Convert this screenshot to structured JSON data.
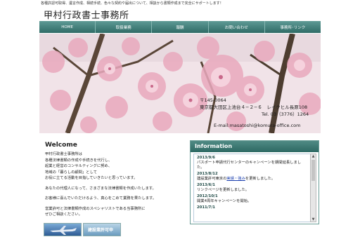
{
  "header": {
    "tagline": "各種許認可取得、遺言作成、相続手続、色々な契約や届出について、相談から書類作成まで完全にサポートします！",
    "title": "甲村行政書士事務所"
  },
  "nav": [
    {
      "label": "HOME"
    },
    {
      "label": "取扱業務"
    },
    {
      "label": "報酬"
    },
    {
      "label": "お問い合わせ"
    },
    {
      "label": "事務所･リンク"
    }
  ],
  "address": {
    "postal": "〒145-0064",
    "street": "東京都大田区上池台４−２−６　レイクヒル長原108",
    "tel": "Tel. 03（3776）1264",
    "email": "E-mail:masatoshi@komura-office.com"
  },
  "welcome": {
    "heading": "Welcome",
    "lines": [
      "甲村行政書士事務所は",
      "各種法律書類の作成や手続きを代行し、",
      "起業と経営のコンサルティングに努め、",
      "地域の「暮らしの顧問」として",
      "お役に立てる活動を目指していきたいと思っています。"
    ],
    "para2": "あなたの代理人になって、さまざまな法律書類を作成いたします。",
    "para3": "お客様に喜んでいただけるよう、真心をこめて業務を果たします。",
    "para4a": "営業許可と法律書類作成のスペシャリストである当事務所に",
    "para4b": "ぜひご相談ください。"
  },
  "banners": {
    "banner2_label": "建設業許可申"
  },
  "info": {
    "heading": "Information",
    "items": [
      {
        "date": "2013/9/6",
        "text": "パスポート申請代行センターのキャンペーンを期間延長しました。"
      },
      {
        "date": "2013/8/12",
        "text_pre": "建設業許可東京の",
        "link": "実績・強み",
        "text_post": "を更新しました。"
      },
      {
        "date": "2013/6/1",
        "text": "リンクページを更新しました。"
      },
      {
        "date": "2012/10/1",
        "text": "開業4周年キャンペーンを開始。"
      },
      {
        "date": "2011/7/1",
        "text": ""
      }
    ]
  }
}
